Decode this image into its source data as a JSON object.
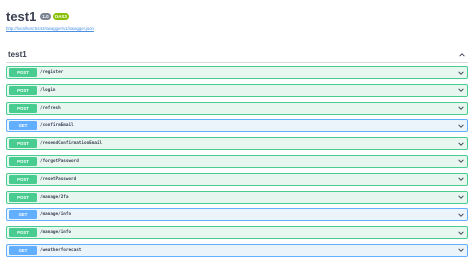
{
  "info": {
    "title": "test1",
    "version": "1.0",
    "oas_badge": "OAS3",
    "spec_url": "http://localhost:5442/swagger/v1/swagger.json"
  },
  "tag": {
    "name": "test1"
  },
  "operations": [
    {
      "method": "POST",
      "path": "/register"
    },
    {
      "method": "POST",
      "path": "/login"
    },
    {
      "method": "POST",
      "path": "/refresh"
    },
    {
      "method": "GET",
      "path": "/confirmEmail"
    },
    {
      "method": "POST",
      "path": "/resendConfirmationEmail"
    },
    {
      "method": "POST",
      "path": "/forgotPassword"
    },
    {
      "method": "POST",
      "path": "/resetPassword"
    },
    {
      "method": "POST",
      "path": "/manage/2fa"
    },
    {
      "method": "GET",
      "path": "/manage/info"
    },
    {
      "method": "POST",
      "path": "/manage/info"
    },
    {
      "method": "GET",
      "path": "/weatherforecast"
    }
  ],
  "colors": {
    "post": "#49cc90",
    "get": "#61affe",
    "version_badge": "#7d8492",
    "oas_badge": "#89bf04"
  },
  "icons": {
    "collapse": "chevron-up-icon",
    "expand": "chevron-down-icon"
  }
}
